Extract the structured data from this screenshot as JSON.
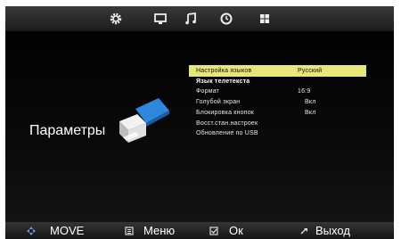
{
  "top_icons": [
    "gear-icon",
    "monitor-icon",
    "music-note-icon",
    "clock-icon",
    "grid-icon"
  ],
  "page_title": "Параметры",
  "menu": {
    "items": [
      {
        "label": "Настройка языков",
        "value": "Русский",
        "selected": true
      },
      {
        "label": "Язык телетекста",
        "value": "",
        "header": true
      },
      {
        "label": "Формат",
        "value": "16:9"
      },
      {
        "label": "Голубой экран",
        "value": "Вкл"
      },
      {
        "label": "Блокировка кнопок",
        "value": "Вкл"
      },
      {
        "label": "Восст.стан.настроек",
        "value": ""
      },
      {
        "label": "Обновление по USB",
        "value": ""
      }
    ]
  },
  "hints": [
    {
      "icon": "move-arrows-icon",
      "label": "MOVE"
    },
    {
      "icon": "menu-icon",
      "label": "Меню"
    },
    {
      "icon": "ok-icon",
      "label": "Ок"
    },
    {
      "icon": "exit-icon",
      "label": "Выход"
    }
  ],
  "colors": {
    "highlight": "#e6e67a",
    "accent_blue": "#3a8fe0"
  }
}
